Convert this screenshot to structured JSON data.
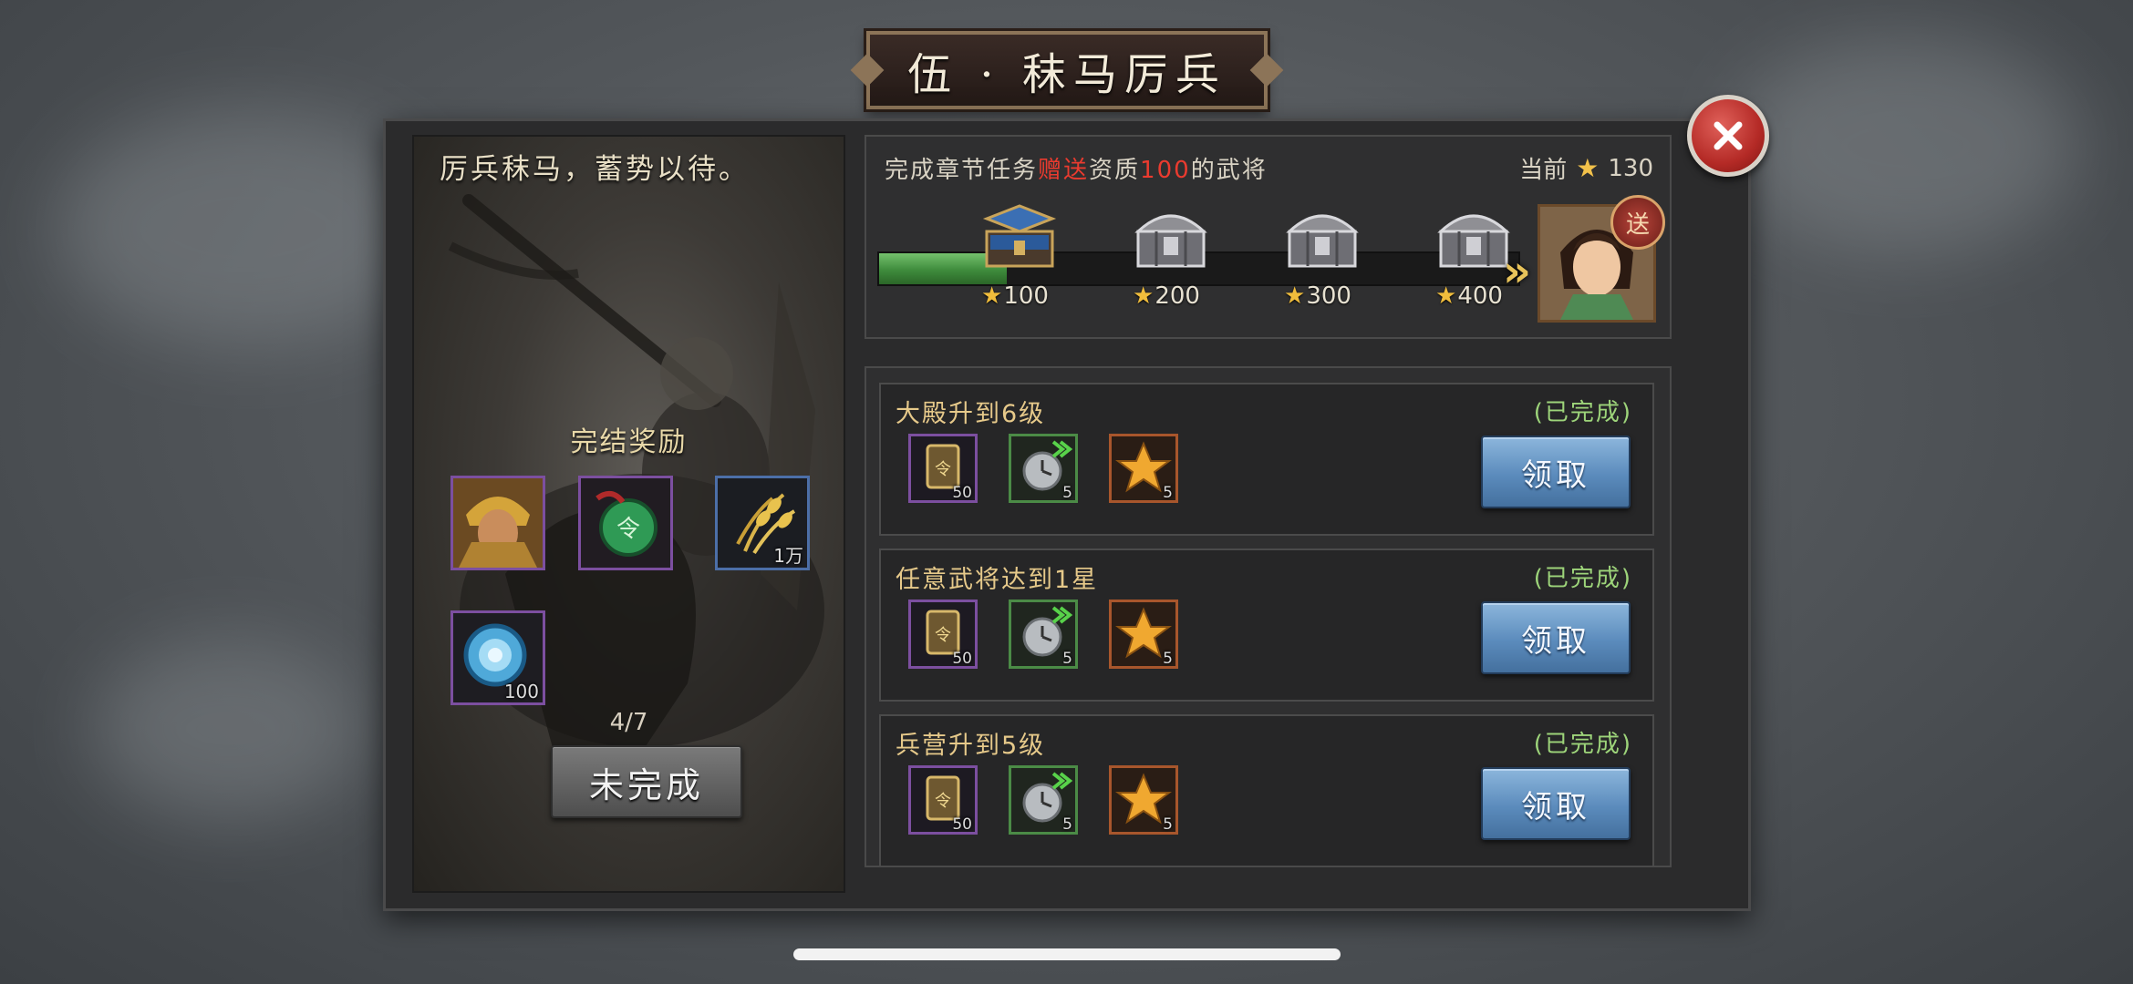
{
  "title": "伍 · 秣马厉兵",
  "story": {
    "quote": "厉兵秣马，蓄势以待。",
    "reward_title": "完结奖励",
    "rewards": [
      {
        "icon": "general-portrait-icon",
        "qty": ""
      },
      {
        "icon": "command-token-icon",
        "qty": ""
      },
      {
        "icon": "grain-icon",
        "qty": "1万"
      },
      {
        "icon": "blue-orb-icon",
        "qty": "100"
      }
    ],
    "progress": "4/7",
    "incomplete_label": "未完成"
  },
  "chapter": {
    "desc_prefix": "完成章节任务",
    "desc_highlight": "赠送",
    "desc_mid": "资质",
    "desc_number": "100",
    "desc_suffix": "的武将",
    "current_label": "当前",
    "current_stars": "130",
    "progress_fraction": 0.2,
    "milestones": [
      {
        "label": "100",
        "opened": true
      },
      {
        "label": "200",
        "opened": false
      },
      {
        "label": "300",
        "opened": false
      },
      {
        "label": "400",
        "opened": false
      }
    ],
    "badge": "送"
  },
  "tasks": [
    {
      "title": "大殿升到6级",
      "status": "(已完成)",
      "claim": "领取",
      "items": [
        {
          "icon": "scroll-card-icon",
          "qty": "50"
        },
        {
          "icon": "speedup-clock-icon",
          "qty": "5"
        },
        {
          "icon": "gold-star-icon",
          "qty": "5"
        }
      ]
    },
    {
      "title": "任意武将达到1星",
      "status": "(已完成)",
      "claim": "领取",
      "items": [
        {
          "icon": "scroll-card-icon",
          "qty": "50"
        },
        {
          "icon": "speedup-clock-icon",
          "qty": "5"
        },
        {
          "icon": "gold-star-icon",
          "qty": "5"
        }
      ]
    },
    {
      "title": "兵营升到5级",
      "status": "(已完成)",
      "claim": "领取",
      "items": [
        {
          "icon": "scroll-card-icon",
          "qty": "50"
        },
        {
          "icon": "speedup-clock-icon",
          "qty": "5"
        },
        {
          "icon": "gold-star-icon",
          "qty": "5"
        }
      ]
    }
  ],
  "colors": {
    "highlight_red": "#ea3b2f",
    "status_green": "#9dd47a",
    "progress_green": "#3e8b3c",
    "claim_blue": "#5b8bbc",
    "close_red": "#b42a26"
  }
}
